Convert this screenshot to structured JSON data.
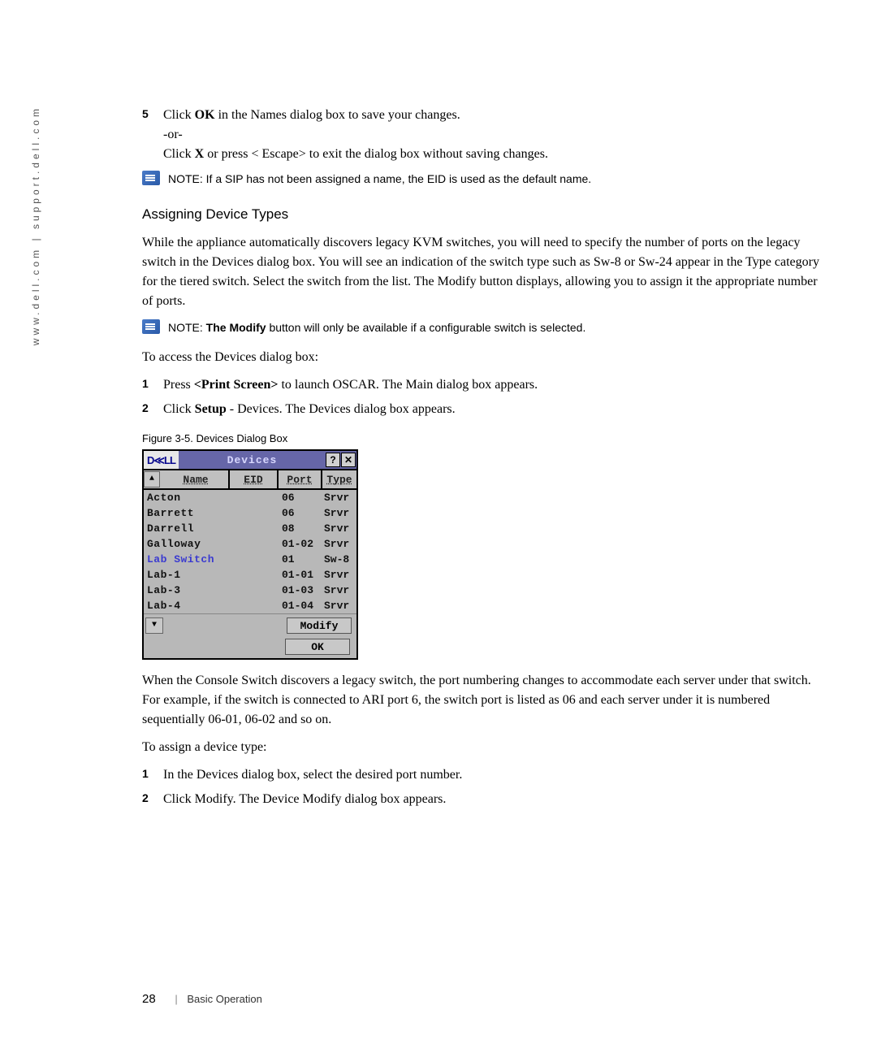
{
  "side_url": "www.dell.com | support.dell.com",
  "steps1": [
    {
      "num": "5",
      "lines": [
        {
          "pre": "Click ",
          "bold": "OK",
          "post": " in the Names dialog box to save your changes."
        },
        {
          "pre": "-or-",
          "bold": "",
          "post": ""
        },
        {
          "pre": "Click ",
          "bold": "X",
          "post": " or press < Escape>  to exit the dialog box without saving changes."
        }
      ]
    }
  ],
  "note1": {
    "label": "NOTE:",
    "text": " If a SIP has not been assigned a name, the EID is used as the default name."
  },
  "subheading": "Assigning Device Types",
  "para1": "While the appliance automatically discovers legacy KVM switches, you will need to specify the number of ports on the legacy switch in the Devices dialog box. You will see an indication of the switch type such as Sw-8 or Sw-24 appear in the Type category for the tiered switch. Select the switch from the list. The Modify button displays, allowing you to assign it the appropriate number of ports.",
  "note2": {
    "label": "NOTE:",
    "bold": " The Modify",
    "text": " button will only be available if a configurable switch is selected."
  },
  "access_line": "To access the Devices dialog box:",
  "steps2": [
    {
      "num": "1",
      "pre": "Press ",
      "bold": "<Print Screen>",
      "post": " to launch OSCAR. The Main dialog box appears."
    },
    {
      "num": "2",
      "pre": "Click ",
      "bold": "Setup",
      "post": " - Devices. The Devices dialog box appears."
    }
  ],
  "figure_caption": "Figure 3-5.    Devices Dialog Box",
  "dialog": {
    "logo": "D≪LL",
    "title": "Devices",
    "help": "?",
    "close_x": "✕",
    "sort_up": "▲",
    "scroll_down": "▼",
    "cols": {
      "name": "Name",
      "eid": "EID",
      "port": "Port",
      "type": "Type"
    },
    "rows": [
      {
        "name": "Acton",
        "port": "06",
        "type": "Srvr",
        "sel": false
      },
      {
        "name": "Barrett",
        "port": "06",
        "type": "Srvr",
        "sel": false
      },
      {
        "name": "Darrell",
        "port": "08",
        "type": "Srvr",
        "sel": false
      },
      {
        "name": "Galloway",
        "port": "01-02",
        "type": "Srvr",
        "sel": false
      },
      {
        "name": "Lab Switch",
        "port": "01",
        "type": "Sw-8",
        "sel": true
      },
      {
        "name": "Lab-1",
        "port": "01-01",
        "type": "Srvr",
        "sel": false
      },
      {
        "name": "Lab-3",
        "port": "01-03",
        "type": "Srvr",
        "sel": false
      },
      {
        "name": "Lab-4",
        "port": "01-04",
        "type": "Srvr",
        "sel": false
      }
    ],
    "modify": "Modify",
    "ok": "OK"
  },
  "para2": "When the Console Switch discovers a legacy switch, the port numbering changes to accommodate each server under that switch. For example, if the switch is connected to ARI port 6, the switch port is listed as 06 and each server under it is numbered sequentially 06-01, 06-02 and so on.",
  "assign_line": "To assign a device type:",
  "steps3": [
    {
      "num": "1",
      "text": "In the Devices dialog box, select the desired port number."
    },
    {
      "num": "2",
      "text": "Click Modify. The Device Modify dialog box appears."
    }
  ],
  "footer": {
    "page": "28",
    "section": "Basic Operation"
  }
}
